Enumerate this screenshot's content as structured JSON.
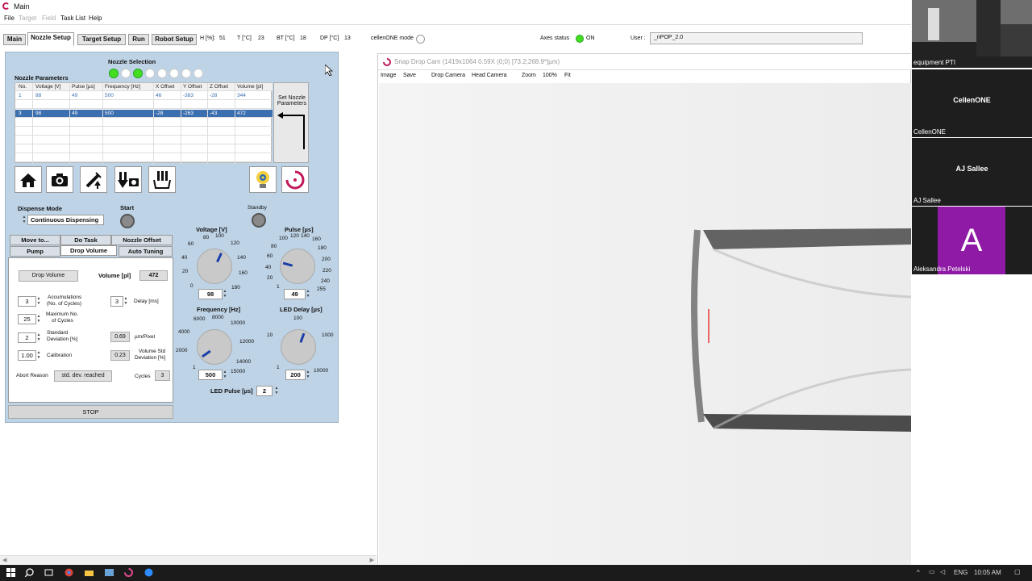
{
  "window": {
    "title": "Main"
  },
  "menu": {
    "file": "File",
    "target": "Target",
    "field": "Field",
    "task_list": "Task List",
    "help": "Help"
  },
  "tabs": [
    "Main",
    "Nozzle Setup",
    "Target Setup",
    "Run",
    "Robot Setup"
  ],
  "header": {
    "h_label": "H [%]:",
    "h_value": "51",
    "t_label": "T [°C]",
    "t_value": "23",
    "bt_label": "BT [°C]",
    "bt_value": "18",
    "dp_label": "DP [°C]",
    "dp_value": "13",
    "mode_label": "cellenONE mode",
    "axes_label": "Axes status",
    "axes_value": "ON",
    "user_label": "User :",
    "user_value": "_nPOP_2.0"
  },
  "nozzle": {
    "selection_label": "Nozzle Selection",
    "params_label": "Nozzle Parameters",
    "columns": [
      "No.",
      "Voltage [V]",
      "Pulse [µs]",
      "Frequency [Hz]",
      "X Offset",
      "Y Offset",
      "Z Offset",
      "Volume [pl]"
    ],
    "rows": [
      [
        "1",
        "88",
        "49",
        "500",
        "46",
        "-383",
        "-28",
        "344"
      ],
      [
        "3",
        "98",
        "49",
        "500",
        "-28",
        "-263",
        "-43",
        "472"
      ]
    ],
    "set_button": "Set Nozzle Parameters"
  },
  "dispense": {
    "mode_label": "Dispense Mode",
    "mode_value": "Continuous Dispensing",
    "start_label": "Start",
    "standby_label": "Standby"
  },
  "subtabs": {
    "row1": [
      "Move to...",
      "Do Task",
      "Nozzle Offset"
    ],
    "row2": [
      "Pump",
      "Drop Volume",
      "Auto Tuning"
    ]
  },
  "drop_volume": {
    "button": "Drop Volume",
    "volume_label": "Volume [pl]",
    "volume_value": "472",
    "accumulations_value": "3",
    "accumulations_label1": "Accumulations",
    "accumulations_label2": "(No. of Cycles)",
    "delay_value": "3",
    "delay_label": "Delay [ms]",
    "max_cycles_value": "25",
    "max_cycles_label1": "Maximum No.",
    "max_cycles_label2": "of Cycles",
    "std_dev_value": "2",
    "std_dev_label1": "Standard",
    "std_dev_label2": "Deviation [%]",
    "um_pixel_value": "0.69",
    "um_pixel_label": "µm/Pixel",
    "calibration_value": "1.00",
    "calibration_label": "Calibration",
    "vol_std_value": "0.23",
    "vol_std_label1": "Volume Std",
    "vol_std_label2": "Deviation [%]",
    "abort_label": "Abort Reason",
    "abort_value": "std. dev. reached",
    "cycles_label": "Cycles",
    "cycles_value": "3"
  },
  "stop_button": "STOP",
  "knobs": {
    "voltage": {
      "label": "Voltage [V]",
      "value": "98",
      "ticks": [
        "0",
        "20",
        "40",
        "60",
        "80",
        "100",
        "120",
        "140",
        "160",
        "180"
      ]
    },
    "pulse": {
      "label": "Pulse [µs]",
      "value": "49",
      "ticks": [
        "1",
        "20",
        "40",
        "60",
        "80",
        "100",
        "120",
        "140",
        "160",
        "180",
        "200",
        "220",
        "240",
        "255"
      ]
    },
    "frequency": {
      "label": "Frequency [Hz]",
      "value": "500",
      "ticks": [
        "1",
        "2000",
        "4000",
        "6000",
        "8000",
        "10000",
        "12000",
        "14000",
        "15000"
      ]
    },
    "led_delay": {
      "label": "LED Delay [µs]",
      "value": "200",
      "ticks": [
        "1",
        "10",
        "100",
        "1000",
        "10000"
      ]
    }
  },
  "led_pulse": {
    "label": "LED Pulse [µs]",
    "value": "2"
  },
  "camera": {
    "title": "Snap Drop Cam (1419x1064 0.59X (0;0) [73.2;268.9*]µm)",
    "menu": [
      "Image",
      "Save",
      "Drop Camera",
      "Head Camera",
      "Zoom",
      "100%",
      "Fit"
    ]
  },
  "participants": [
    {
      "name": "equipment PTI",
      "center": ""
    },
    {
      "name": "CellenONE",
      "center": "CellenONE"
    },
    {
      "name": "AJ Sallee",
      "center": "AJ Sallee"
    },
    {
      "name": "Aleksandra Petelski",
      "center": "A"
    }
  ],
  "taskbar": {
    "lang": "ENG",
    "time": "10:05 AM"
  },
  "colors": {
    "panel": "#bed3e6",
    "selected_row": "#3b6faf",
    "led_green": "#44dd22",
    "avatar": "#8e1aa6",
    "accent": "#c2185b"
  }
}
